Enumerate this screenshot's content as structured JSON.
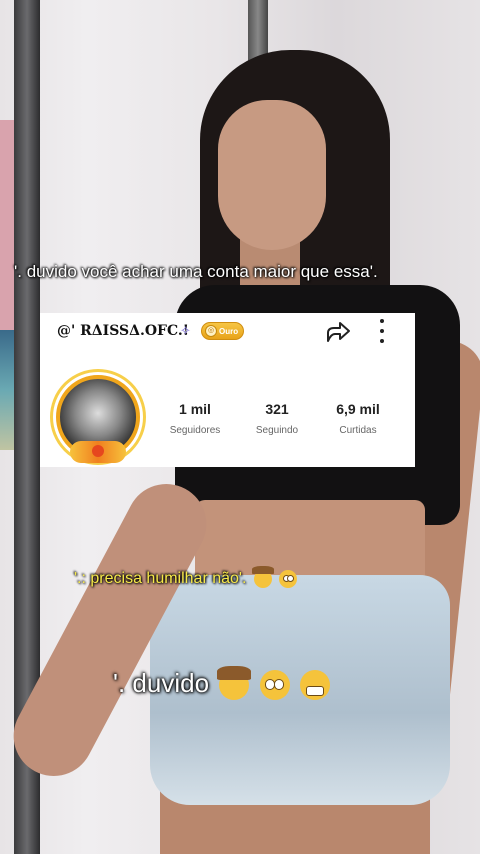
{
  "caption_top": "'. duvido você achar uma conta maior que essa'.",
  "profile_card": {
    "username": "@' RΔISSΔ.OFC.!",
    "badge_label": "Ouro",
    "stats": [
      {
        "value": "1 mil",
        "label": "Seguidores"
      },
      {
        "value": "321",
        "label": "Seguindo"
      },
      {
        "value": "6,9 mil",
        "label": "Curtidas"
      }
    ]
  },
  "subtitle_1": "'.: precisa humilhar não'.",
  "subtitle_2": "'. duvido",
  "icons": {
    "share": "share-arrow-icon",
    "more": "more-vertical-icon",
    "badge": "gold-coin-icon",
    "emoji": [
      "cowboy-emoji-icon",
      "eye-roll-emoji-icon",
      "grin-emoji-icon"
    ]
  },
  "colors": {
    "badge_gold": "#f0a61c",
    "subtitle_yellow": "#f7e94a"
  }
}
